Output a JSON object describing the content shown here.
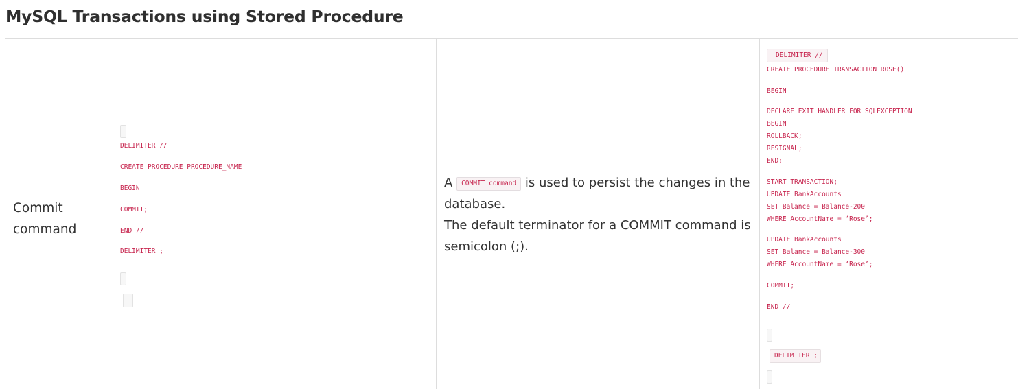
{
  "page": {
    "title": "MySQL Transactions using Stored Procedure"
  },
  "row": {
    "command_name": "Commit command",
    "syntax_lines": [
      "DELIMITER //",
      "CREATE PROCEDURE PROCEDURE_NAME",
      "BEGIN",
      "COMMIT;",
      "END //",
      "DELIMITER ;"
    ],
    "description": {
      "prefix": "A",
      "inline_code": "COMMIT command",
      "suffix": "is used to persist the changes in the database.",
      "line2": "The default terminator for a COMMIT command is semicolon (;)."
    },
    "example": {
      "delimiter_start": "DELIMITER //",
      "lines": [
        "CREATE PROCEDURE TRANSACTION_ROSE()",
        "BEGIN",
        "DECLARE EXIT HANDLER FOR SQLEXCEPTION",
        "BEGIN",
        "ROLLBACK;",
        "RESIGNAL;",
        "END;",
        "START TRANSACTION;",
        "UPDATE BankAccounts",
        "SET Balance = Balance-200",
        "WHERE AccountName = ‘Rose’;",
        "UPDATE BankAccounts",
        "SET Balance = Balance-300",
        "WHERE AccountName = ‘Rose’;",
        "COMMIT;",
        "END //"
      ],
      "delimiter_end": "DELIMITER ;"
    }
  },
  "colors": {
    "code_text": "#c7254e",
    "code_bg": "#f9f2f4",
    "border": "#dddddd",
    "text": "#333333"
  }
}
